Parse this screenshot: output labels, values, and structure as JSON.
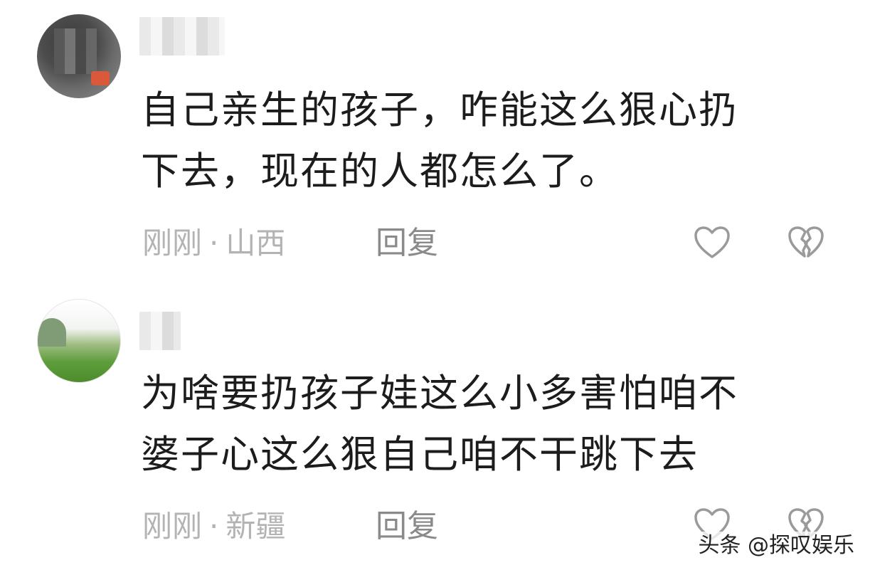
{
  "comments": [
    {
      "text_lines": [
        "自己亲生的孩子，咋能这么狠心扔",
        "下去，现在的人都怎么了。"
      ],
      "time": "刚刚",
      "separator": "·",
      "location": "山西",
      "reply_label": "回复",
      "like_icon": "heart-outline-icon",
      "dislike_icon": "broken-heart-icon"
    },
    {
      "text_lines": [
        "为啥要扔孩子娃这么小多害怕咱不",
        "婆子心这么狠自己咱不干跳下去"
      ],
      "time": "刚刚",
      "separator": "·",
      "location": "新疆",
      "reply_label": "回复",
      "like_icon": "heart-outline-icon",
      "dislike_icon": "broken-heart-icon"
    }
  ],
  "watermark": "头条 @探叹娱乐",
  "colors": {
    "body_text": "#1c1c1c",
    "meta_text": "#b3b3b3",
    "reply_text": "#8a8a8a",
    "icon_stroke": "#9a9a9a",
    "background": "#ffffff"
  }
}
